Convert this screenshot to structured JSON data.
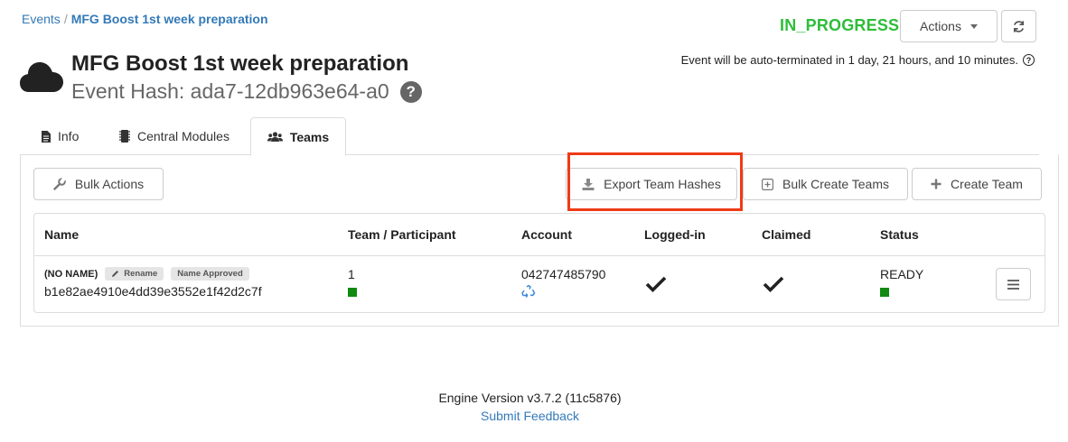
{
  "breadcrumb": {
    "root": "Events",
    "separator": "/",
    "current": "MFG Boost 1st week preparation"
  },
  "event": {
    "status": "IN_PROGRESS",
    "title": "MFG Boost 1st week preparation",
    "hash_label": "Event Hash: ada7-12db963e64-a0",
    "auto_terminate": "Event will be auto-terminated in 1 day, 21 hours, and 10 minutes."
  },
  "header_actions": {
    "actions_label": "Actions"
  },
  "tabs": [
    {
      "label": "Info",
      "icon": "file-icon"
    },
    {
      "label": "Central Modules",
      "icon": "chip-icon"
    },
    {
      "label": "Teams",
      "icon": "users-icon",
      "active": true
    }
  ],
  "toolbar": {
    "bulk_actions": "Bulk Actions",
    "export_hashes": "Export Team Hashes",
    "bulk_create": "Bulk Create Teams",
    "create_team": "Create Team"
  },
  "table": {
    "headers": [
      "Name",
      "Team / Participant",
      "Account",
      "Logged-in",
      "Claimed",
      "Status"
    ],
    "rows": [
      {
        "name": "(NO NAME)",
        "rename": "Rename",
        "approved": "Name Approved",
        "hash": "b1e82ae4910e4dd39e3552e1f42d2c7f",
        "participant": "1",
        "account": "042747485790",
        "logged_in": true,
        "claimed": true,
        "status": "READY"
      }
    ]
  },
  "footer": {
    "version": "Engine Version v3.7.2 (11c5876)",
    "feedback": "Submit Feedback"
  },
  "colors": {
    "status_green": "#2ebd3a",
    "link_blue": "#337ab7",
    "highlight_red": "#f03a17",
    "indicator_green": "#118a11"
  }
}
